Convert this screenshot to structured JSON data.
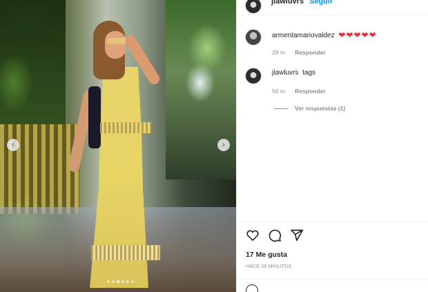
{
  "header": {
    "username": "jlawluvrs",
    "follow_label": "Seguir"
  },
  "carousel": {
    "prev_glyph": "‹",
    "next_glyph": "›",
    "dots": 6,
    "active_dot": 3
  },
  "comments": [
    {
      "username": "armentamariovaldez",
      "text": "❤❤❤❤❤",
      "time": "29 m",
      "reply_label": "Responder"
    },
    {
      "username": "jlawluvrs",
      "text": "tags",
      "time": "56 m",
      "reply_label": "Responder"
    }
  ],
  "view_replies_label": "Ver respuestas (1)",
  "actions": {
    "like_icon": "heart-icon",
    "comment_icon": "comment-icon",
    "share_icon": "send-icon"
  },
  "likes_label": "17 Me gusta",
  "timestamp_label": "HACE 56 MINUTOS",
  "colors": {
    "link_blue": "#0095f6",
    "heart_red": "#ed2d3f",
    "muted_text": "#8e8e8e"
  }
}
